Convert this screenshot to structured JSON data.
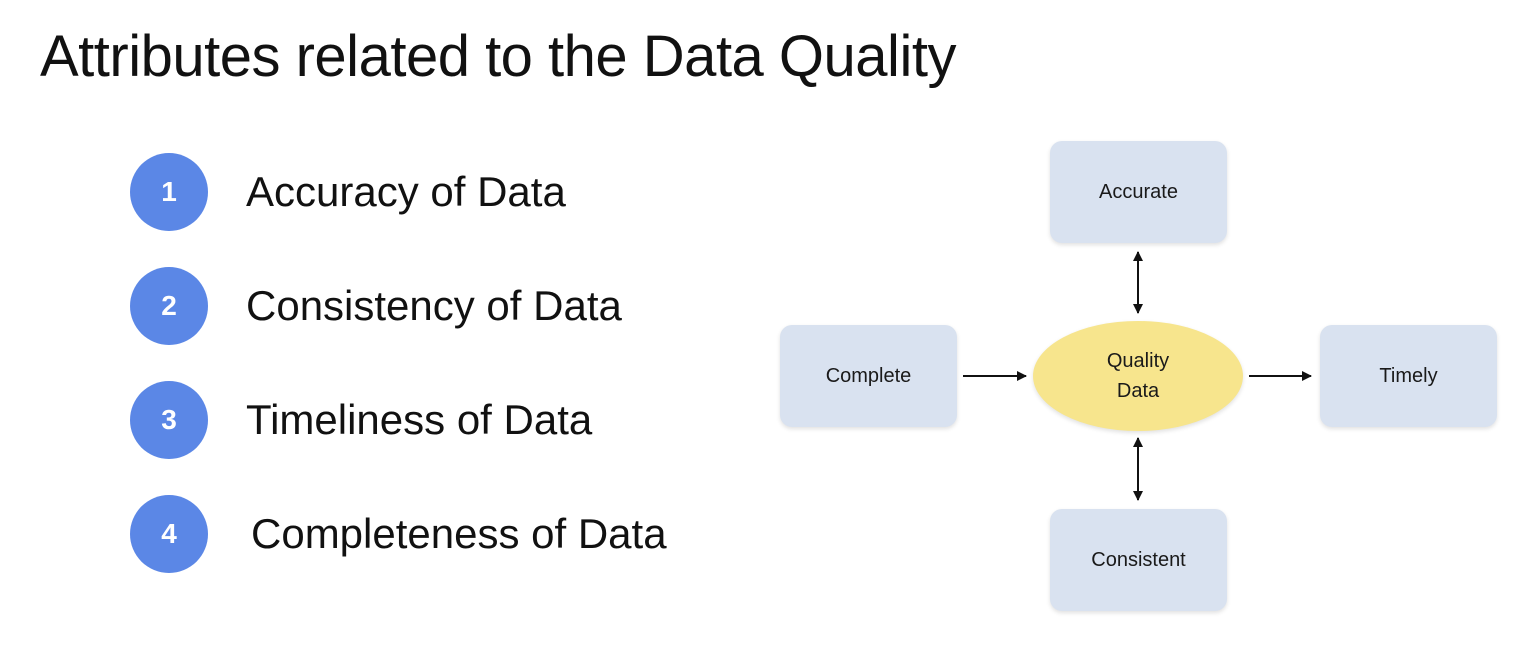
{
  "title": "Attributes related to the Data Quality",
  "list": [
    {
      "number": "1",
      "label": "Accuracy of Data"
    },
    {
      "number": "2",
      "label": "Consistency of Data"
    },
    {
      "number": "3",
      "label": "Timeliness of Data"
    },
    {
      "number": "4",
      "label": "Completeness of Data"
    }
  ],
  "diagram": {
    "center": {
      "line1": "Quality",
      "line2": "Data"
    },
    "top": "Accurate",
    "left": "Complete",
    "right": "Timely",
    "bottom": "Consistent"
  },
  "colors": {
    "number_circle": "#5b87e6",
    "attribute_box": "#d9e2f0",
    "center_ellipse": "#f7e58d"
  }
}
